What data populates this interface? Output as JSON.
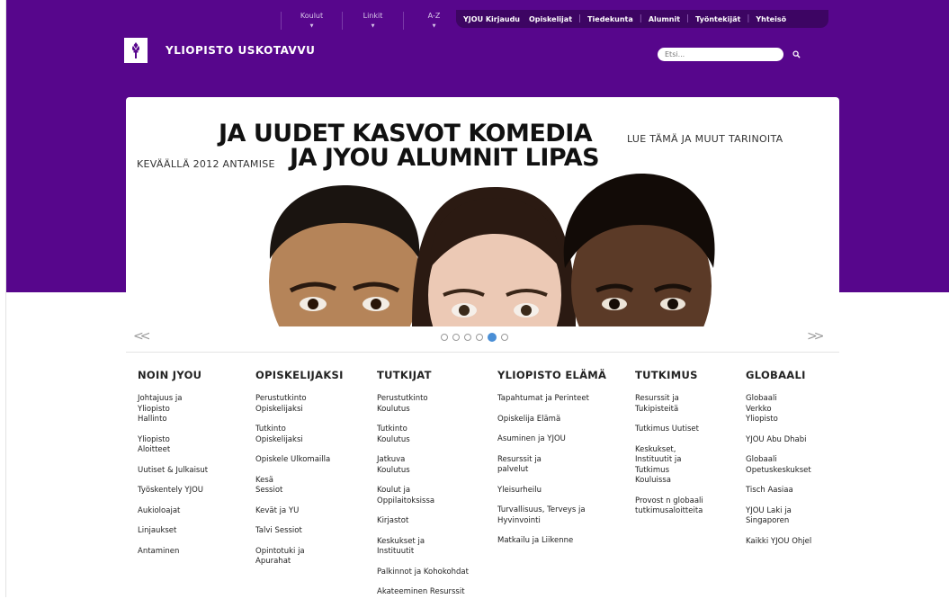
{
  "brand": {
    "logo_text": "YLIOPISTO USKOTAVVU",
    "purple": "#57068c",
    "logo_icon": "torch-icon"
  },
  "topnav": {
    "dropdowns": [
      "Koulut",
      "Linkit",
      "A-Z"
    ],
    "login": "YJOU Kirjaudu",
    "links": [
      "Opiskelijat",
      "Tiedekunta",
      "Alumnit",
      "Työntekijät",
      "Yhteisö"
    ]
  },
  "search": {
    "placeholder": "Etsi...",
    "icon": "search-icon"
  },
  "hero": {
    "line1": "JA UUDET KASVOT KOMEDIA",
    "line2": "JA JYOU ALUMNIT LIPAS",
    "side1": "LUE TÄMÄ JA MUUT TARINOITA",
    "side2": "KEVÄÄLLÄ 2012 ANTAMISE",
    "prev_label": "<<",
    "next_label": ">>",
    "slide_count": 6,
    "active_slide": 5
  },
  "columns": [
    {
      "title": "NOIN JYOU",
      "links": [
        "Johtajuus ja\nYliopisto\nHallinto",
        "Yliopisto\nAloitteet",
        "Uutiset & Julkaisut",
        "Työskentely YJOU",
        "Aukioloajat",
        "Linjaukset",
        "Antaminen"
      ]
    },
    {
      "title": "OPISKELIJAKSI",
      "links": [
        "Perustutkinto\nOpiskelijaksi",
        "Tutkinto\nOpiskelijaksi",
        "Opiskele Ulkomailla",
        "Kesä\nSessiot",
        "Kevät ja YU",
        "Talvi Sessiot",
        "Opintotuki ja\nApurahat"
      ]
    },
    {
      "title": "TUTKIJAT",
      "links": [
        "Perustutkinto\nKoulutus",
        "Tutkinto\nKoulutus",
        "Jatkuva\nKoulutus",
        "Koulut ja\nOppilaitoksissa",
        "Kirjastot",
        "Keskukset ja\nInstituutit",
        "Palkinnot ja Kohokohdat",
        "Akateeminen Resurssit"
      ]
    },
    {
      "title": "YLIOPISTO ELÄMÄ",
      "links": [
        "Tapahtumat ja Perinteet",
        "Opiskelija Elämä",
        "Asuminen ja YJOU",
        "Resurssit ja\npalvelut",
        "Yleisurheilu",
        "Turvallisuus, Terveys ja\nHyvinvointi",
        "Matkailu ja Liikenne"
      ]
    },
    {
      "title": "TUTKIMUS",
      "links": [
        "Resurssit ja\nTukipisteitä",
        "Tutkimus Uutiset",
        "Keskukset,\nInstituutit ja\nTutkimus\nKouluissa",
        "Provost n globaali\ntutkimusaloitteita"
      ]
    },
    {
      "title": "GLOBAALI",
      "links": [
        "Globaali\nVerkko\nYliopisto",
        "YJOU Abu Dhabi",
        "Globaali\nOpetuskeskukset",
        "Tisch Aasiaa",
        "YJOU Laki ja\nSingaporen",
        "Kaikki YJOU Ohjel"
      ]
    }
  ]
}
